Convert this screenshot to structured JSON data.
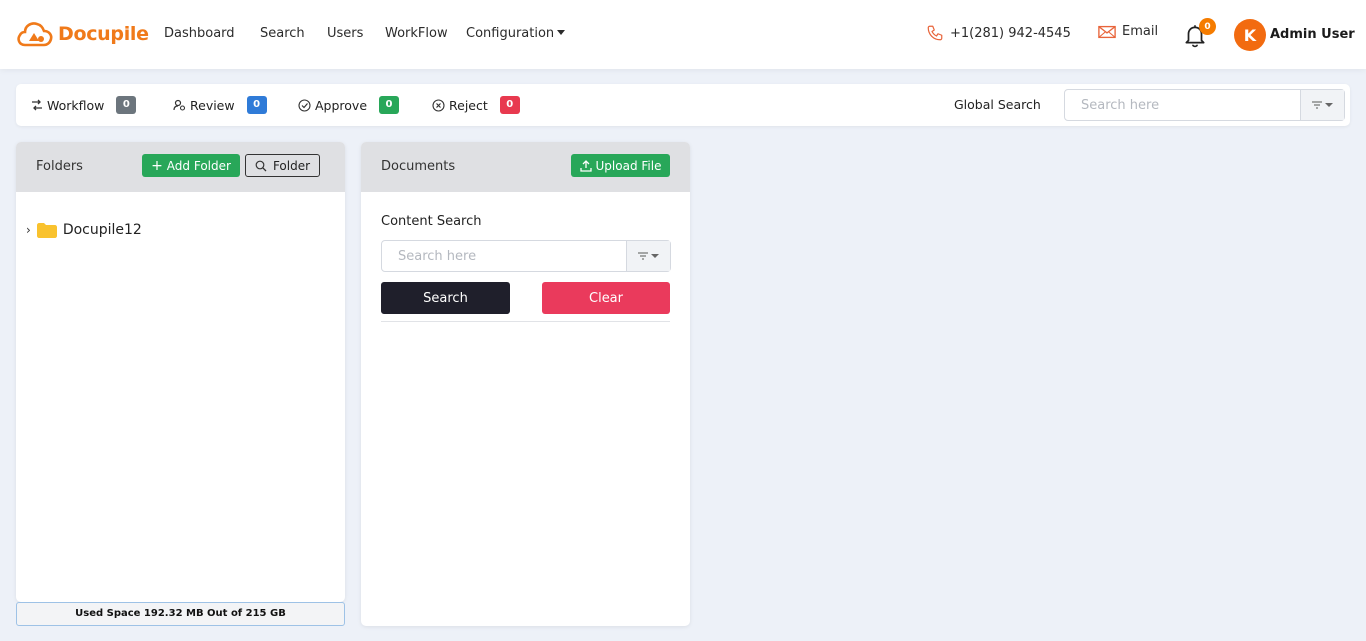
{
  "brand": {
    "name": "Docupile",
    "color": "#f07a1a"
  },
  "nav": {
    "links": [
      "Dashboard",
      "Search",
      "Users",
      "WorkFlow"
    ],
    "config_label": "Configuration"
  },
  "contact": {
    "phone": "+1(281) 942-4545",
    "email_label": "Email"
  },
  "notifications": {
    "count": "0"
  },
  "user": {
    "initial": "K",
    "name": "Admin User"
  },
  "toolbar": {
    "items": [
      {
        "label": "Workflow",
        "count": "0",
        "color": "#6c757d",
        "icon": "workflow-icon"
      },
      {
        "label": "Review",
        "count": "0",
        "color": "#2f7bd8",
        "icon": "review-icon"
      },
      {
        "label": "Approve",
        "count": "0",
        "color": "#28a759",
        "icon": "check-circle-icon"
      },
      {
        "label": "Reject",
        "count": "0",
        "color": "#e8394f",
        "icon": "x-circle-icon"
      }
    ],
    "global_search_label": "Global Search",
    "global_search_placeholder": "Search here"
  },
  "folders": {
    "title": "Folders",
    "add_button": "Add Folder",
    "search_button": "Folder",
    "tree": [
      {
        "name": "Docupile12",
        "icon": "folder-icon"
      }
    ],
    "used_space": "Used Space 192.32 MB Out of 215 GB"
  },
  "documents": {
    "title": "Documents",
    "upload_button": "Upload File",
    "content_search_label": "Content Search",
    "search_placeholder": "Search here",
    "search_button": "Search",
    "clear_button": "Clear"
  }
}
